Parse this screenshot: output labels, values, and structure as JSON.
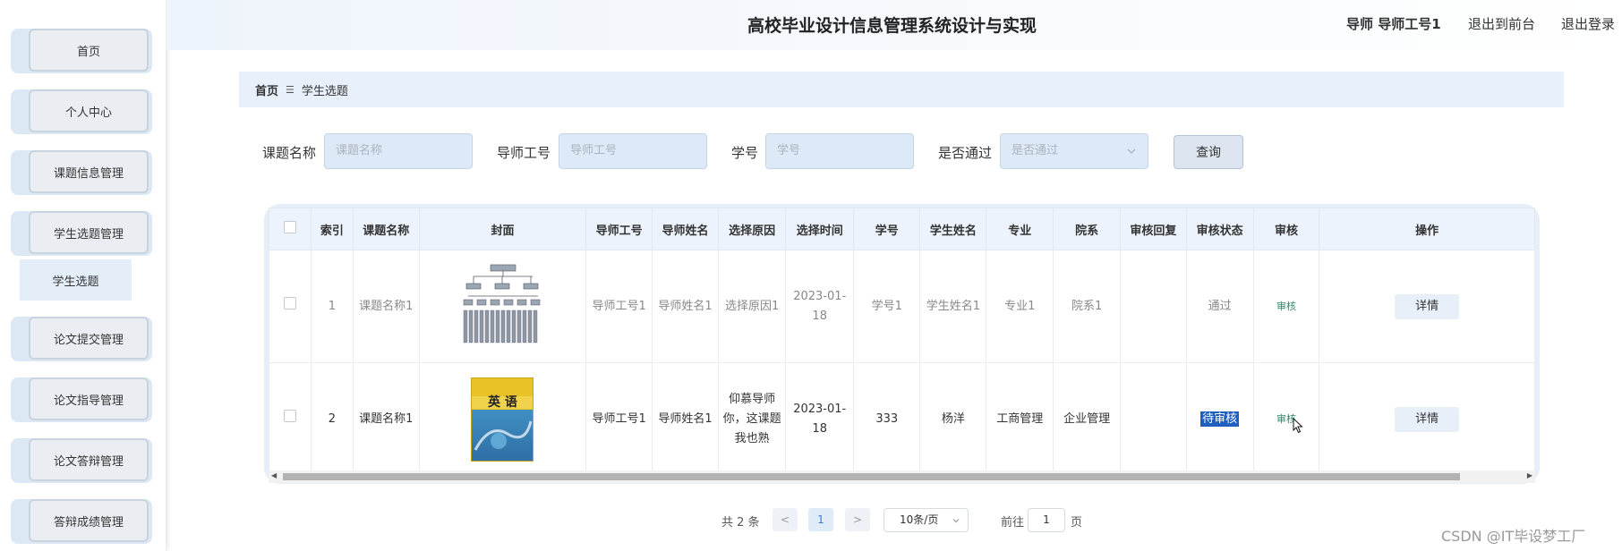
{
  "sidebar": {
    "items": [
      {
        "label": "首页"
      },
      {
        "label": "个人中心"
      },
      {
        "label": "课题信息管理"
      },
      {
        "label": "学生选题管理"
      },
      {
        "label": "论文提交管理"
      },
      {
        "label": "论文指导管理"
      },
      {
        "label": "论文答辩管理"
      },
      {
        "label": "答辩成绩管理"
      }
    ],
    "submenu": {
      "label": "学生选题"
    }
  },
  "header": {
    "title": "高校毕业设计信息管理系统设计与实现",
    "user": "导师 导师工号1",
    "back_front": "退出到前台",
    "logout": "退出登录"
  },
  "breadcrumb": {
    "home": "首页",
    "separator": "☰",
    "current": "学生选题"
  },
  "search": {
    "topic_label": "课题名称",
    "topic_placeholder": "课题名称",
    "teacher_label": "导师工号",
    "teacher_placeholder": "导师工号",
    "student_label": "学号",
    "student_placeholder": "学号",
    "pass_label": "是否通过",
    "pass_placeholder": "是否通过",
    "query_button": "查询"
  },
  "table": {
    "headers": [
      "索引",
      "课题名称",
      "封面",
      "导师工号",
      "导师姓名",
      "选择原因",
      "选择时间",
      "学号",
      "学生姓名",
      "专业",
      "院系",
      "审核回复",
      "审核状态",
      "审核",
      "操作"
    ],
    "rows": [
      {
        "index": "1",
        "topic": "课题名称1",
        "cover": "org-chart-cover",
        "teacher_no": "导师工号1",
        "teacher_name": "导师姓名1",
        "reason": "选择原因1",
        "time": "2023-01-18",
        "student_no": "学号1",
        "student_name": "学生姓名1",
        "major": "专业1",
        "college": "院系1",
        "reply": "",
        "status": "通过",
        "audit": "审核",
        "action": "详情"
      },
      {
        "index": "2",
        "topic": "课题名称1",
        "cover": "english-book-cover",
        "teacher_no": "导师工号1",
        "teacher_name": "导师姓名1",
        "reason": "仰慕导师你，这课题我也熟",
        "time": "2023-01-18",
        "student_no": "333",
        "student_name": "杨洋",
        "major": "工商管理",
        "college": "企业管理",
        "reply": "",
        "status": "待审核",
        "audit": "审核",
        "action": "详情"
      }
    ],
    "book_title": "英 语"
  },
  "pagination": {
    "total": "共 2 条",
    "prev": "<",
    "current_page": "1",
    "next": ">",
    "page_size": "10条/页",
    "goto_label": "前往",
    "goto_value": "1",
    "page_unit": "页"
  },
  "watermark": "CSDN @IT毕设梦工厂",
  "colors": {
    "accent": "#3a7bd5",
    "selection": "#1f5fbf",
    "audit_link": "#2b8a6b"
  }
}
